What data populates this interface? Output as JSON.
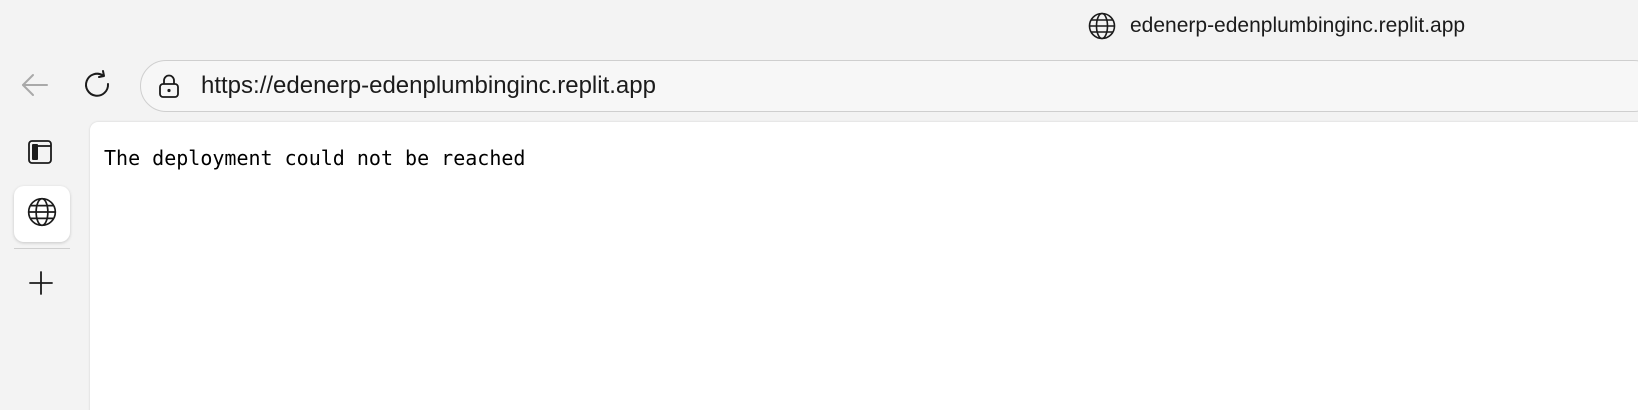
{
  "window": {
    "title": "edenerp-edenplumbinginc.replit.app"
  },
  "toolbar": {
    "back_icon": "back-arrow-icon",
    "refresh_icon": "refresh-icon",
    "address": {
      "lock_icon": "lock-icon",
      "url": "https://edenerp-edenplumbinginc.replit.app"
    }
  },
  "tabstrip": {
    "tab_actions_icon": "tab-actions-icon",
    "tabs": [
      {
        "icon": "globe-icon",
        "active": true
      }
    ],
    "new_tab_icon": "plus-icon"
  },
  "page": {
    "message": "The deployment could not be reached"
  },
  "colors": {
    "chrome_background": "#f3f3f3",
    "content_background": "#ffffff",
    "text": "#1b1b1b"
  }
}
